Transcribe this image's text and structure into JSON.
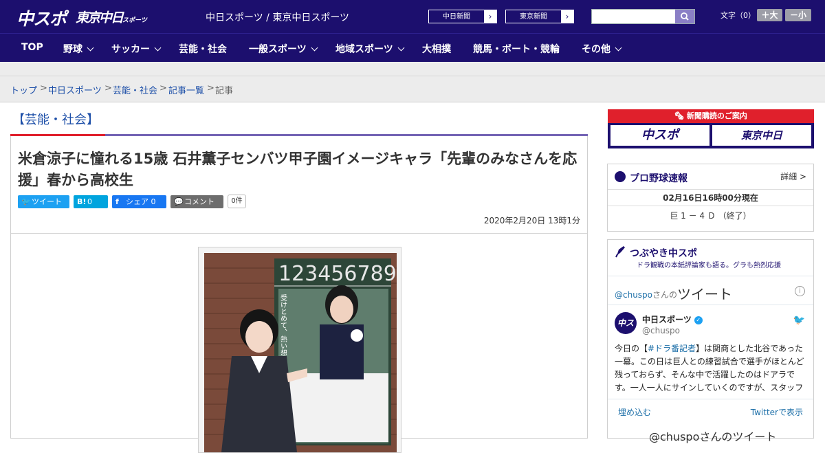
{
  "header": {
    "logo_main": "中スポ",
    "logo_tokyo": "東京中日",
    "logo_tokyo_small": "スポーツ",
    "site_name": "中日スポーツ / 東京中日スポーツ",
    "paper_buttons": [
      "中日新聞",
      "東京新聞"
    ],
    "search_placeholder": "",
    "font_size_label": "文字（0）",
    "font_bigger": "＋大",
    "font_smaller": "－小"
  },
  "nav": {
    "items": [
      {
        "label": "TOP",
        "dropdown": false
      },
      {
        "label": "野球",
        "dropdown": true
      },
      {
        "label": "サッカー",
        "dropdown": true
      },
      {
        "label": "芸能・社会",
        "dropdown": false
      },
      {
        "label": "一般スポーツ",
        "dropdown": true
      },
      {
        "label": "地域スポーツ",
        "dropdown": true
      },
      {
        "label": "大相撲",
        "dropdown": false
      },
      {
        "label": "競馬・ボート・競輪",
        "dropdown": false
      },
      {
        "label": "その他",
        "dropdown": true
      }
    ]
  },
  "breadcrumb": {
    "items": [
      "トップ",
      "中日スポーツ",
      "芸能・社会",
      "記事一覧",
      "記事"
    ],
    "separator": ">"
  },
  "article": {
    "category": "【芸能・社会】",
    "title": "米倉涼子に憧れる15歳 石井薫子センバツ甲子園イメージキャラ「先輩のみなさんを応援」春から高校生",
    "share": {
      "tweet": "ツイート",
      "hatena_count": "0",
      "facebook": "シェア 0",
      "comment": "コメント",
      "comment_count": "0件"
    },
    "date": "2020年2月20日 13時1分",
    "photo_caption_poster": "受けとめて、熱い想い。"
  },
  "sidebar": {
    "ad": {
      "header": "新聞購読のご案内",
      "left": "中スポ",
      "right": "東京中日"
    },
    "baseball": {
      "title": "プロ野球速報",
      "more": "詳細 >",
      "time": "02月16日16時00分現在",
      "score": "巨 1 － 4 Ｄ （終了）"
    },
    "tweets": {
      "title": "つぶやき中スポ",
      "subtitle": "ドラ観戦の本紙評論家も語る。グラも熱烈応援",
      "handle_prefix": "@chuspo",
      "handle_suffix": "さんの",
      "heading": "ツイート",
      "account_name": "中日スポーツ",
      "account_handle": "@chuspo",
      "tweet_pre": "今日の【",
      "tweet_tag": "#ドラ番記者",
      "tweet_post": "】は関商とした北谷であった一幕。この日は巨人との練習試合で選手がほとんど残っておらず、そんな中で活躍したのはドアラです。一人一人にサインしていくのですが、スタッフ",
      "embed": "埋め込む",
      "view": "Twitterで表示",
      "next": "@chuspoさんのツイート"
    }
  },
  "colors": {
    "brand_navy": "#1c0f6e",
    "accent_red": "#e0202c",
    "link_blue": "#1d4fa8"
  }
}
